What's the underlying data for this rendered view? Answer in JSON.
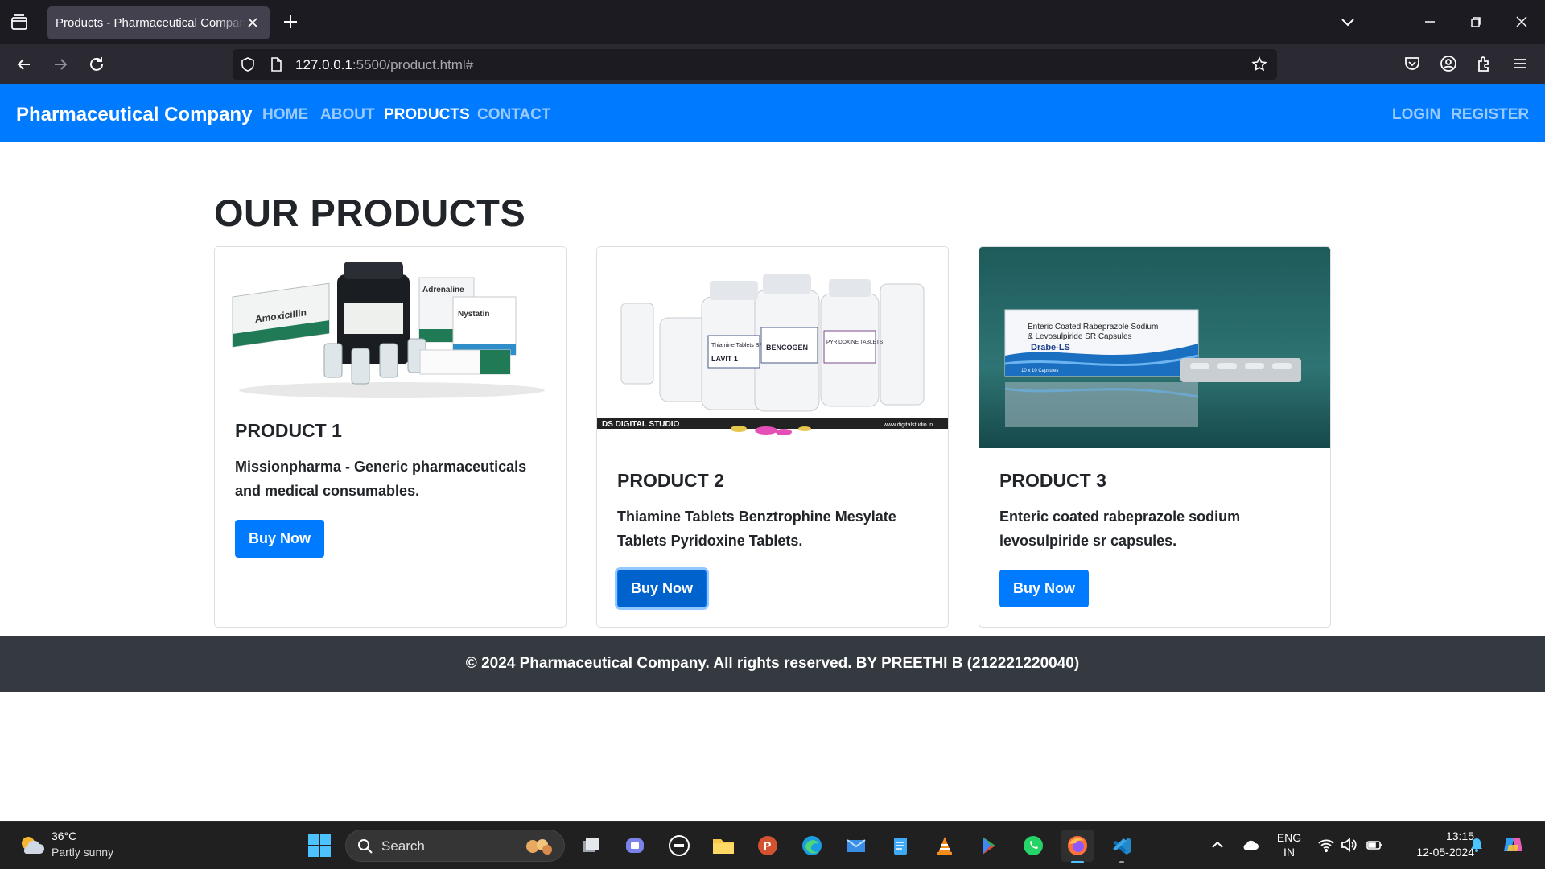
{
  "browser": {
    "tab_title": "Products - Pharmaceutical Company",
    "url_host": "127.0.0.1",
    "url_rest": ":5500/product.html#"
  },
  "site": {
    "brand": "Pharmaceutical Company",
    "menu": [
      "HOME",
      "ABOUT",
      "PRODUCTS",
      "CONTACT"
    ],
    "active_menu": "PRODUCTS",
    "auth": {
      "login": "LOGIN",
      "register": "REGISTER"
    },
    "page_title": "OUR PRODUCTS",
    "products": [
      {
        "title": "PRODUCT 1",
        "description": "Missionpharma - Generic pharmaceuticals and medical consumables.",
        "button": "Buy Now",
        "image_labels": [
          "Amoxicillin",
          "Adrenaline",
          "Nystatin"
        ]
      },
      {
        "title": "PRODUCT 2",
        "description": "Thiamine Tablets Benztrophine Mesylate Tablets Pyridoxine Tablets.",
        "button": "Buy Now",
        "image_labels": [
          "Thiamine Tablets BP 100 mg",
          "LAVIT 1",
          "BENCOGEN",
          "PYRIDOXINE TABLETS",
          "DS DIGITAL STUDIO",
          "www.digitalstudio.in"
        ]
      },
      {
        "title": "PRODUCT 3",
        "description": "Enteric coated rabeprazole sodium levosulpiride sr capsules.",
        "button": "Buy Now",
        "image_labels": [
          "Enteric Coated Rabeprazole Sodium",
          "& Levosulpiride SR Capsules",
          "Drabe-LS",
          "10 x 10 Capsules"
        ]
      }
    ],
    "footer": "© 2024 Pharmaceutical Company. All rights reserved. BY PREETHI B (212221220040)"
  },
  "taskbar": {
    "weather_temp": "36°C",
    "weather_desc": "Partly sunny",
    "search_label": "Search",
    "lang_top": "ENG",
    "lang_bottom": "IN",
    "time": "13:15",
    "date": "12-05-2024"
  },
  "colors": {
    "primary": "#007bff",
    "footer_bg": "#343a40",
    "text_dark": "#212529"
  }
}
